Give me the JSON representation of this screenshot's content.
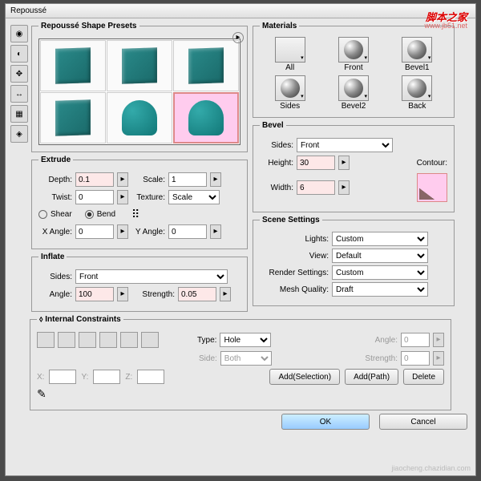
{
  "title": "Repoussé",
  "wm1": "脚本之家",
  "wm2": "www.jb51.net",
  "wm3": "jiaocheng.chazidian.com",
  "presets": {
    "legend": "Repoussé Shape Presets"
  },
  "extrude": {
    "legend": "Extrude",
    "depth_l": "Depth:",
    "depth": "0.1",
    "scale_l": "Scale:",
    "scale": "1",
    "twist_l": "Twist:",
    "twist": "0",
    "texture_l": "Texture:",
    "texture": "Scale",
    "shear": "Shear",
    "bend": "Bend",
    "xang_l": "X Angle:",
    "xang": "0",
    "yang_l": "Y Angle:",
    "yang": "0"
  },
  "inflate": {
    "legend": "Inflate",
    "sides_l": "Sides:",
    "sides": "Front",
    "angle_l": "Angle:",
    "angle": "100",
    "strength_l": "Strength:",
    "strength": "0.05"
  },
  "materials": {
    "legend": "Materials",
    "items": [
      "All",
      "Front",
      "Bevel1",
      "Sides",
      "Bevel2",
      "Back"
    ]
  },
  "bevel": {
    "legend": "Bevel",
    "sides_l": "Sides:",
    "sides": "Front",
    "height_l": "Height:",
    "height": "30",
    "width_l": "Width:",
    "width": "6",
    "contour_l": "Contour:"
  },
  "scene": {
    "legend": "Scene Settings",
    "lights_l": "Lights:",
    "lights": "Custom",
    "view_l": "View:",
    "view": "Default",
    "render_l": "Render Settings:",
    "render": "Custom",
    "mesh_l": "Mesh Quality:",
    "mesh": "Draft"
  },
  "ic": {
    "legend": "Internal Constraints",
    "type_l": "Type:",
    "type": "Hole",
    "side_l": "Side:",
    "side": "Both",
    "angle_l": "Angle:",
    "angle": "0",
    "strength_l": "Strength:",
    "strength": "0",
    "x": "X:",
    "y": "Y:",
    "z": "Z:",
    "addsel": "Add(Selection)",
    "addpath": "Add(Path)",
    "del": "Delete"
  },
  "ok": "OK",
  "cancel": "Cancel"
}
